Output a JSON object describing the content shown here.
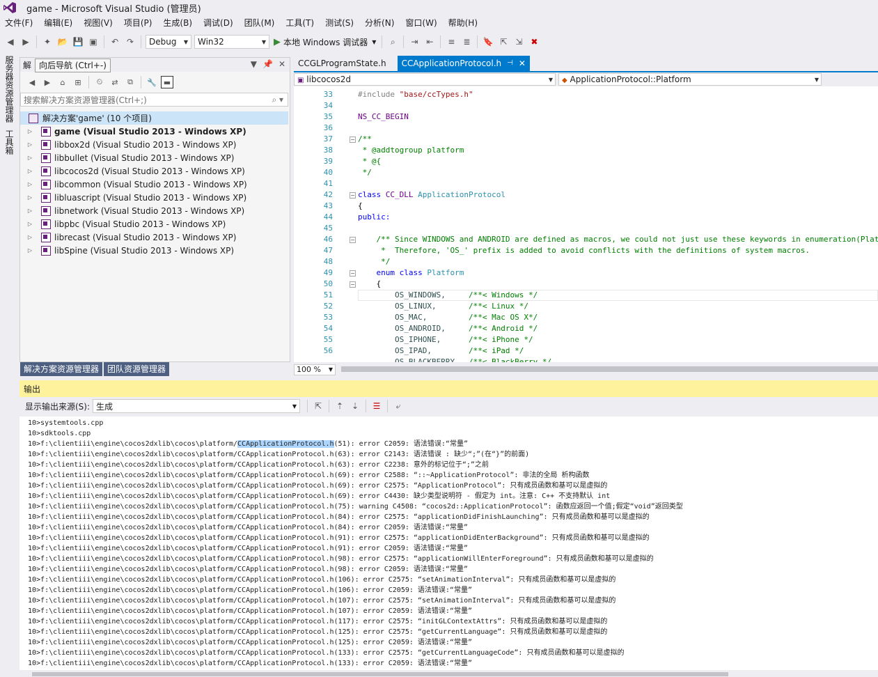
{
  "window": {
    "title": "game - Microsoft Visual Studio (管理员)"
  },
  "menu": [
    "文件(F)",
    "编辑(E)",
    "视图(V)",
    "项目(P)",
    "生成(B)",
    "调试(D)",
    "团队(M)",
    "工具(T)",
    "测试(S)",
    "分析(N)",
    "窗口(W)",
    "帮助(H)"
  ],
  "toolbar": {
    "config": "Debug",
    "platform": "Win32",
    "debug_target": "本地 Windows 调试器"
  },
  "left_strip": {
    "tab1": "服务器资源管理器",
    "tab2": "工具箱"
  },
  "solution": {
    "header": "解",
    "tooltip": "向后导航 (Ctrl+-)",
    "search_placeholder": "搜索解决方案资源管理器(Ctrl+;)",
    "root": "解决方案'game' (10 个项目)",
    "projects": [
      "game (Visual Studio 2013 - Windows XP)",
      "libbox2d (Visual Studio 2013 - Windows XP)",
      "libbullet (Visual Studio 2013 - Windows XP)",
      "libcocos2d (Visual Studio 2013 - Windows XP)",
      "libcommon (Visual Studio 2013 - Windows XP)",
      "libluascript (Visual Studio 2013 - Windows XP)",
      "libnetwork (Visual Studio 2013 - Windows XP)",
      "libpbc (Visual Studio 2013 - Windows XP)",
      "librecast (Visual Studio 2013 - Windows XP)",
      "libSpine (Visual Studio 2013 - Windows XP)"
    ],
    "tab_active": "解决方案资源管理器",
    "tab_inactive": "团队资源管理器"
  },
  "editor": {
    "tabs": [
      "CCGLProgramState.h",
      "CCApplicationProtocol.h"
    ],
    "nav_left": "libcocos2d",
    "nav_right": "ApplicationProtocol::Platform",
    "zoom": "100 %",
    "line_numbers": [
      "33",
      "34",
      "35",
      "36",
      "37",
      "38",
      "39",
      "40",
      "41",
      "42",
      "43",
      "44",
      "45",
      "46",
      "47",
      "48",
      "49",
      "50",
      "51",
      "52",
      "53",
      "54",
      "55",
      "56"
    ],
    "code": {
      "l33_pp": "#include ",
      "l33_str": "\"base/ccTypes.h\"",
      "l35": "NS_CC_BEGIN",
      "l37": "/**",
      "l38": " * @addtogroup platform",
      "l39": " * @{",
      "l40": " */",
      "l42_kw": "class ",
      "l42_mac": "CC_DLL ",
      "l42_ty": "ApplicationProtocol",
      "l43": "{",
      "l44": "public:",
      "l46": "    /** Since WINDOWS and ANDROID are defined as macros, we could not just use these keywords in enumeration(Platform).",
      "l47": "     *  Therefore, 'OS_' prefix is added to avoid conflicts with the definitions of system macros.",
      "l48": "     */",
      "l49_kw": "    enum class ",
      "l49_ty": "Platform",
      "l50": "    {",
      "l51_e": "        OS_WINDOWS,     ",
      "l51_c": "/**< Windows */",
      "l52_e": "        OS_LINUX,       ",
      "l52_c": "/**< Linux */",
      "l53_e": "        OS_MAC,         ",
      "l53_c": "/**< Mac OS X*/",
      "l54_e": "        OS_ANDROID,     ",
      "l54_c": "/**< Android */",
      "l55_e": "        OS_IPHONE,      ",
      "l55_c": "/**< iPhone */",
      "l56_e": "        OS_IPAD,        ",
      "l56_c": "/**< iPad */",
      "l57_e": "        OS_BLACKBERRY,  ",
      "l57_c": "/**< BlackBerry */"
    }
  },
  "output": {
    "title": "输出",
    "source_label": "显示输出来源(S):",
    "source_value": "生成",
    "lines": [
      "10>systemtools.cpp",
      "10>sdktools.cpp",
      "10>f:\\clientiii\\engine\\cocos2dxlib\\cocos\\platform/|CCApplicationProtocol.h|(51): error C2059: 语法错误:“常量”",
      "10>f:\\clientiii\\engine\\cocos2dxlib\\cocos\\platform/CCApplicationProtocol.h(63): error C2143: 语法错误 : 缺少“;”(在“}”的前面)",
      "10>f:\\clientiii\\engine\\cocos2dxlib\\cocos\\platform/CCApplicationProtocol.h(63): error C2238: 意外的标记位于“;”之前",
      "10>f:\\clientiii\\engine\\cocos2dxlib\\cocos\\platform/CCApplicationProtocol.h(69): error C2588: “::~ApplicationProtocol”: 非法的全局 析构函数",
      "10>f:\\clientiii\\engine\\cocos2dxlib\\cocos\\platform/CCApplicationProtocol.h(69): error C2575: “ApplicationProtocol”: 只有成员函数和基可以是虚拟的",
      "10>f:\\clientiii\\engine\\cocos2dxlib\\cocos\\platform/CCApplicationProtocol.h(69): error C4430: 缺少类型说明符 - 假定为 int。注意: C++ 不支持默认 int",
      "10>f:\\clientiii\\engine\\cocos2dxlib\\cocos\\platform/CCApplicationProtocol.h(75): warning C4508: “cocos2d::ApplicationProtocol”: 函数应返回一个值;假定“void”返回类型",
      "10>f:\\clientiii\\engine\\cocos2dxlib\\cocos\\platform/CCApplicationProtocol.h(84): error C2575: “applicationDidFinishLaunching”: 只有成员函数和基可以是虚拟的",
      "10>f:\\clientiii\\engine\\cocos2dxlib\\cocos\\platform/CCApplicationProtocol.h(84): error C2059: 语法错误:“常量”",
      "10>f:\\clientiii\\engine\\cocos2dxlib\\cocos\\platform/CCApplicationProtocol.h(91): error C2575: “applicationDidEnterBackground”: 只有成员函数和基可以是虚拟的",
      "10>f:\\clientiii\\engine\\cocos2dxlib\\cocos\\platform/CCApplicationProtocol.h(91): error C2059: 语法错误:“常量”",
      "10>f:\\clientiii\\engine\\cocos2dxlib\\cocos\\platform/CCApplicationProtocol.h(98): error C2575: “applicationWillEnterForeground”: 只有成员函数和基可以是虚拟的",
      "10>f:\\clientiii\\engine\\cocos2dxlib\\cocos\\platform/CCApplicationProtocol.h(98): error C2059: 语法错误:“常量”",
      "10>f:\\clientiii\\engine\\cocos2dxlib\\cocos\\platform/CCApplicationProtocol.h(106): error C2575: “setAnimationInterval”: 只有成员函数和基可以是虚拟的",
      "10>f:\\clientiii\\engine\\cocos2dxlib\\cocos\\platform/CCApplicationProtocol.h(106): error C2059: 语法错误:“常量”",
      "10>f:\\clientiii\\engine\\cocos2dxlib\\cocos\\platform/CCApplicationProtocol.h(107): error C2575: “setAnimationInterval”: 只有成员函数和基可以是虚拟的",
      "10>f:\\clientiii\\engine\\cocos2dxlib\\cocos\\platform/CCApplicationProtocol.h(107): error C2059: 语法错误:“常量”",
      "10>f:\\clientiii\\engine\\cocos2dxlib\\cocos\\platform/CCApplicationProtocol.h(117): error C2575: “initGLContextAttrs”: 只有成员函数和基可以是虚拟的",
      "10>f:\\clientiii\\engine\\cocos2dxlib\\cocos\\platform/CCApplicationProtocol.h(125): error C2575: “getCurrentLanguage”: 只有成员函数和基可以是虚拟的",
      "10>f:\\clientiii\\engine\\cocos2dxlib\\cocos\\platform/CCApplicationProtocol.h(125): error C2059: 语法错误:“常量”",
      "10>f:\\clientiii\\engine\\cocos2dxlib\\cocos\\platform/CCApplicationProtocol.h(133): error C2575: “getCurrentLanguageCode”: 只有成员函数和基可以是虚拟的",
      "10>f:\\clientiii\\engine\\cocos2dxlib\\cocos\\platform/CCApplicationProtocol.h(133): error C2059: 语法错误:“常量”"
    ]
  },
  "colors": {
    "accent": "#007acc",
    "output_header": "#fff29d",
    "selection": "#cce4f7",
    "vs_purple": "#68217a"
  }
}
